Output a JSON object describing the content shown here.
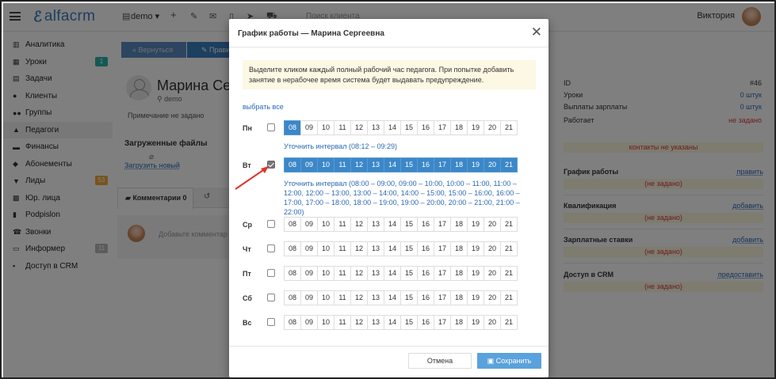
{
  "app": {
    "logo_text": "alfacrm",
    "branch": "demo",
    "search_placeholder": "Поиск клиента",
    "user_name": "Виктория",
    "colors": {
      "accent": "#3a7fc0",
      "selected_hour": "#3b87c8",
      "warning_bg": "#fcf8e3",
      "danger": "#d43c3c"
    }
  },
  "sidebar": {
    "items": [
      {
        "label": "Аналитика",
        "icon": "chart-icon"
      },
      {
        "label": "Уроки",
        "icon": "calendar-icon",
        "badge": "1"
      },
      {
        "label": "Задачи",
        "icon": "tasks-icon"
      },
      {
        "label": "Клиенты",
        "icon": "user-icon"
      },
      {
        "label": "Группы",
        "icon": "group-icon"
      },
      {
        "label": "Педагоги",
        "icon": "graduation-cap-icon"
      },
      {
        "label": "Финансы",
        "icon": "money-icon"
      },
      {
        "label": "Абонементы",
        "icon": "tag-icon"
      },
      {
        "label": "Лиды",
        "icon": "leads-icon",
        "badge": "53"
      },
      {
        "label": "Юр. лица",
        "icon": "building-icon"
      },
      {
        "label": "Podpislon",
        "icon": "document-icon"
      },
      {
        "label": "Звонки",
        "icon": "phone-icon"
      },
      {
        "label": "Информер",
        "icon": "informer-icon",
        "badge": "11"
      },
      {
        "label": "Доступ в CRM",
        "icon": "lock-icon"
      }
    ]
  },
  "teacher": {
    "back_label": "« Вернуться",
    "edit_label": "Прави",
    "name": "Марина Сер",
    "branch": "demo",
    "note": "Примечание не задано",
    "files_title": "Загруженные файлы",
    "upload_label": "Загрузить новый",
    "comments_tab": "Комментарии 0",
    "comment_placeholder": "Добавьте комментар"
  },
  "right_panel": {
    "id_label": "ID",
    "id_value": "#46",
    "lessons_label": "Уроки",
    "lessons_value": "0 штук",
    "payouts_label": "Выплаты зарплаты",
    "payouts_value": "0 штук",
    "works_label": "Работает",
    "works_value": "не задано",
    "contacts": "контакты не указаны",
    "schedule_title": "График работы",
    "schedule_action": "править",
    "schedule_value": "(не задано)",
    "qualification_title": "Квалификация",
    "qualification_action": "добавить",
    "qualification_value": "(не задано)",
    "salary_title": "Зарплатные ставки",
    "salary_action": "добавить",
    "salary_value": "(не задано)",
    "crm_title": "Доступ в CRM",
    "crm_action": "предоставить",
    "crm_value": "(не задано)"
  },
  "modal": {
    "title": "График работы — Марина Сергеевна",
    "alert": "Выделите кликом каждый полный рабочий час педагога. При попытке добавить занятие в нерабочее время система будет выдавать предупреждение.",
    "select_all": "выбрать все",
    "hours": [
      "08",
      "09",
      "10",
      "11",
      "12",
      "13",
      "14",
      "15",
      "16",
      "17",
      "18",
      "19",
      "20",
      "21"
    ],
    "days": [
      {
        "label": "Пн",
        "checked": false,
        "selected": [
          0
        ],
        "interval": "Уточнить интервал (08:12 – 09:29)"
      },
      {
        "label": "Вт",
        "checked": true,
        "selected": [
          0,
          1,
          2,
          3,
          4,
          5,
          6,
          7,
          8,
          9,
          10,
          11,
          12,
          13
        ],
        "interval": "Уточнить интервал (08:00 – 09:00, 09:00 – 10:00, 10:00 – 11:00, 11:00 – 12:00, 12:00 – 13:00, 13:00 – 14:00, 14:00 – 15:00, 15:00 – 16:00, 16:00 – 17:00, 17:00 – 18:00, 18:00 – 19:00, 19:00 – 20:00, 20:00 – 21:00, 21:00 – 22:00)"
      },
      {
        "label": "Ср",
        "checked": false,
        "selected": []
      },
      {
        "label": "Чт",
        "checked": false,
        "selected": []
      },
      {
        "label": "Пт",
        "checked": false,
        "selected": []
      },
      {
        "label": "Сб",
        "checked": false,
        "selected": []
      },
      {
        "label": "Вс",
        "checked": false,
        "selected": []
      }
    ],
    "cancel_label": "Отмена",
    "save_label": "Сохранить"
  }
}
